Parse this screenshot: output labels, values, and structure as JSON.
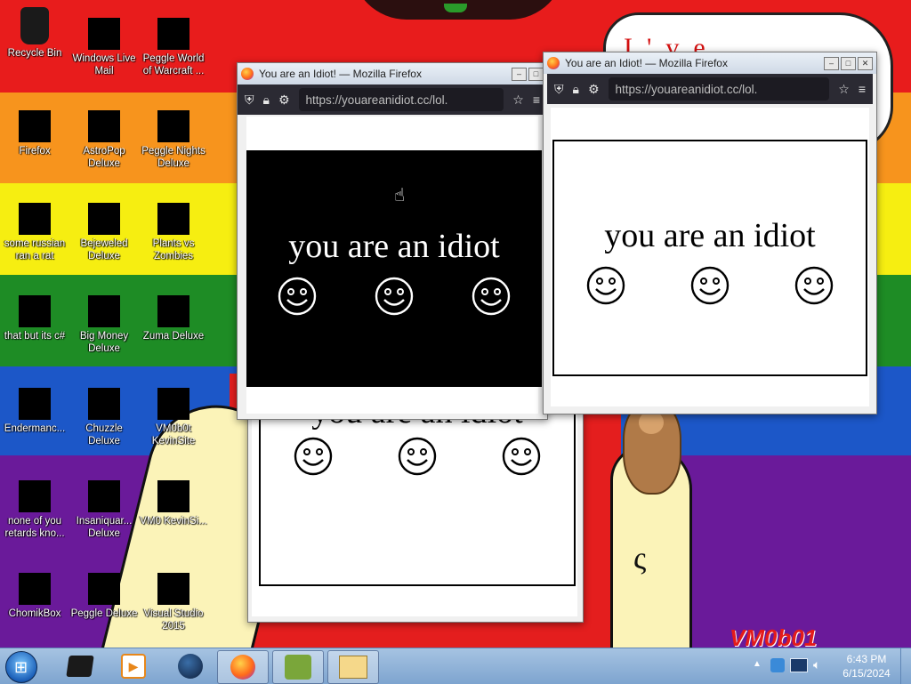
{
  "wallpaper": {
    "speech_text": "I've been...",
    "watermark": "VM0b01"
  },
  "desktop_icons": [
    {
      "label": "Recycle Bin"
    },
    {
      "label": "Windows Live Mail"
    },
    {
      "label": "Peggle World of Warcraft ..."
    },
    {
      "label": "Firefox"
    },
    {
      "label": "AstroPop Deluxe"
    },
    {
      "label": "Peggle Nights Deluxe"
    },
    {
      "label": "some russian ran a rat"
    },
    {
      "label": "Bejeweled Deluxe"
    },
    {
      "label": "Plants vs Zombies"
    },
    {
      "label": "that but its c#"
    },
    {
      "label": "Big Money Deluxe"
    },
    {
      "label": "Zuma Deluxe"
    },
    {
      "label": "Endermanc..."
    },
    {
      "label": "Chuzzle Deluxe"
    },
    {
      "label": "VM0b0t KevinSite"
    },
    {
      "label": "none of you retards kno..."
    },
    {
      "label": "Insaniquar... Deluxe"
    },
    {
      "label": "VM0 KevinSi..."
    },
    {
      "label": "ChomikBox"
    },
    {
      "label": "Peggle Deluxe"
    },
    {
      "label": "Visual Studio 2015"
    }
  ],
  "windows": [
    {
      "title": "You are an Idiot! — Mozilla Firefox",
      "url": "https://youareanidiot.cc/lol.",
      "message": "you are an idiot",
      "theme": "black",
      "panel_bg": "#000000",
      "text_color": "#ffffff"
    },
    {
      "title": "You are an Idiot! — Mozilla Firefox",
      "url": "https://youareanidiot.cc/lol.",
      "message": "you are an idiot",
      "theme": "white",
      "panel_bg": "#ffffff",
      "text_color": "#000000"
    },
    {
      "title": "",
      "url": "",
      "message": "you are an idiot",
      "theme": "white",
      "panel_bg": "#ffffff",
      "text_color": "#000000"
    }
  ],
  "taskbar": {
    "items": [
      {
        "icon": "terminal-icon",
        "active": false
      },
      {
        "icon": "media-player-icon",
        "active": false
      },
      {
        "icon": "globe-icon",
        "active": false
      },
      {
        "icon": "firefox-icon",
        "active": true
      },
      {
        "icon": "chomikbox-icon",
        "active": true
      },
      {
        "icon": "window-explorer-icon",
        "active": true
      }
    ],
    "clock": {
      "time": "6:43 PM",
      "date": "6/15/2024"
    }
  },
  "colors": {
    "red": "#e81c1c",
    "orange": "#f7941d",
    "yellow": "#f6ee11",
    "green": "#1e8c25",
    "blue": "#1c57c8",
    "purple": "#6a1a9a",
    "firefox_toolbar": "#2b2a33"
  }
}
